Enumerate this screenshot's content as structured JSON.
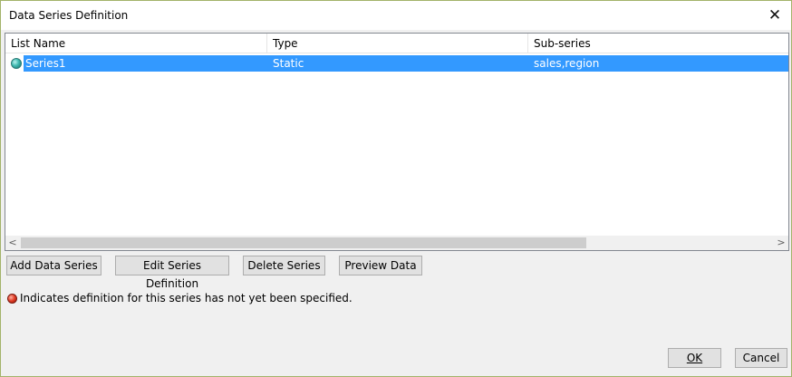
{
  "window": {
    "title": "Data Series Definition",
    "close_glyph": "✕"
  },
  "table": {
    "columns": [
      "List Name",
      "Type",
      "Sub-series"
    ],
    "rows": [
      {
        "status_icon": "teal-status-icon",
        "name": "Series1",
        "type": "Static",
        "subseries": "sales,region",
        "selected": true
      }
    ]
  },
  "scrollbar": {
    "left_arrow": "<",
    "right_arrow": ">"
  },
  "buttons": {
    "add": "Add Data Series",
    "edit": "Edit Series Definition",
    "delete": "Delete Series",
    "preview": "Preview Data"
  },
  "legend": {
    "icon": "red-status-icon",
    "text": "Indicates definition for this series has not yet been specified."
  },
  "footer": {
    "ok": "OK",
    "cancel": "Cancel"
  },
  "colors": {
    "selection": "#3399ff",
    "dialog_bg": "#f0f0f0",
    "border_accent": "#a3b36a"
  }
}
